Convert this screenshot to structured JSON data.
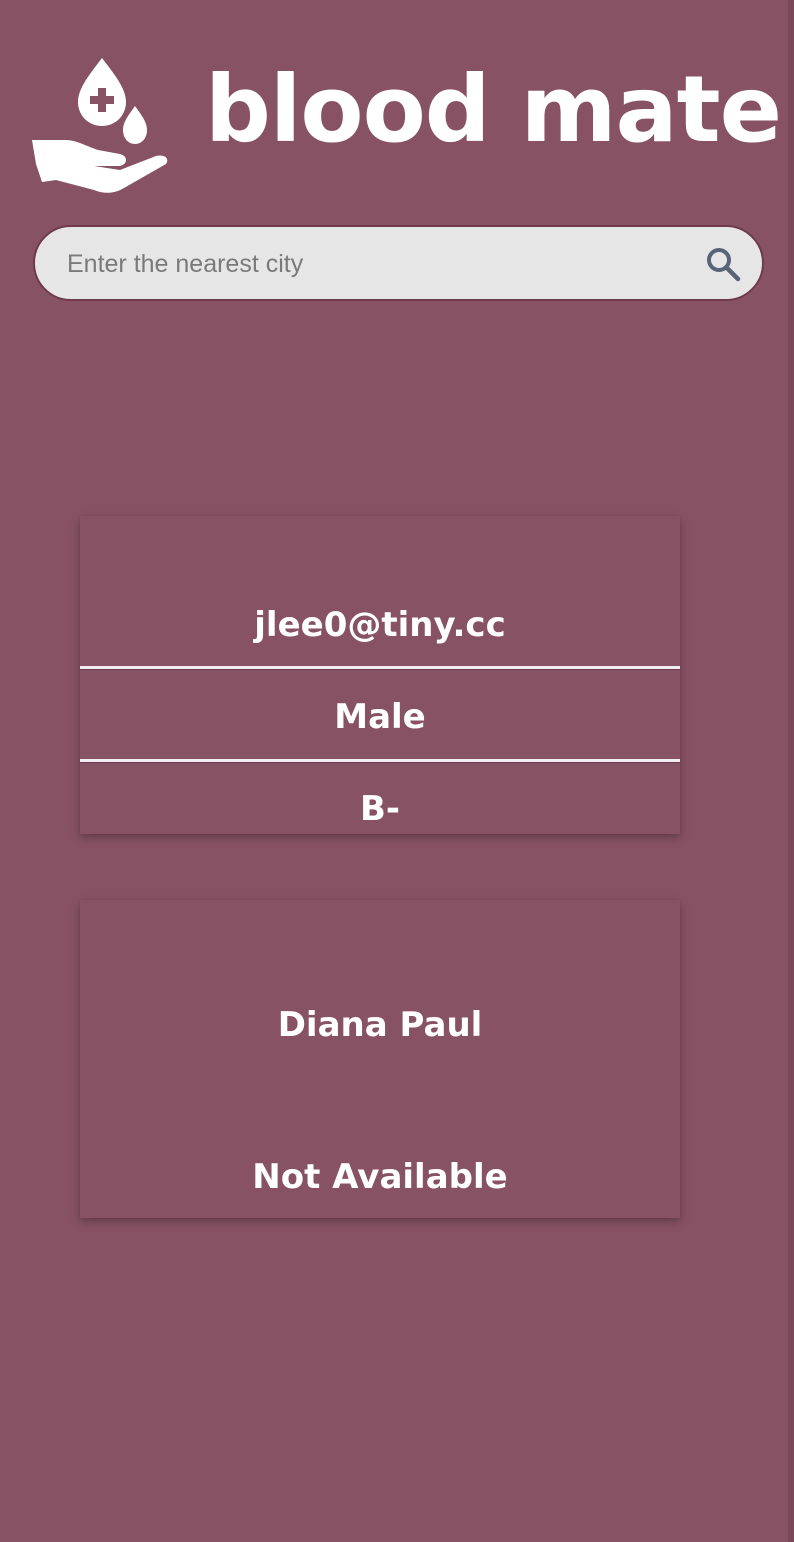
{
  "brand": {
    "name": "blood mate"
  },
  "search": {
    "placeholder": "Enter the nearest city",
    "value": ""
  },
  "donor_card": {
    "email": "jlee0@tiny.cc",
    "gender": "Male",
    "blood_group": "B-"
  },
  "request_card": {
    "name": "Diana Paul",
    "status": "Not Available"
  },
  "colors": {
    "background": "#875264",
    "search_bg": "#e6e6e6",
    "text": "#ffffff",
    "icon": "#5a6478"
  },
  "icons": {
    "logo": "blood-donation-hand-icon",
    "search": "search-icon"
  }
}
